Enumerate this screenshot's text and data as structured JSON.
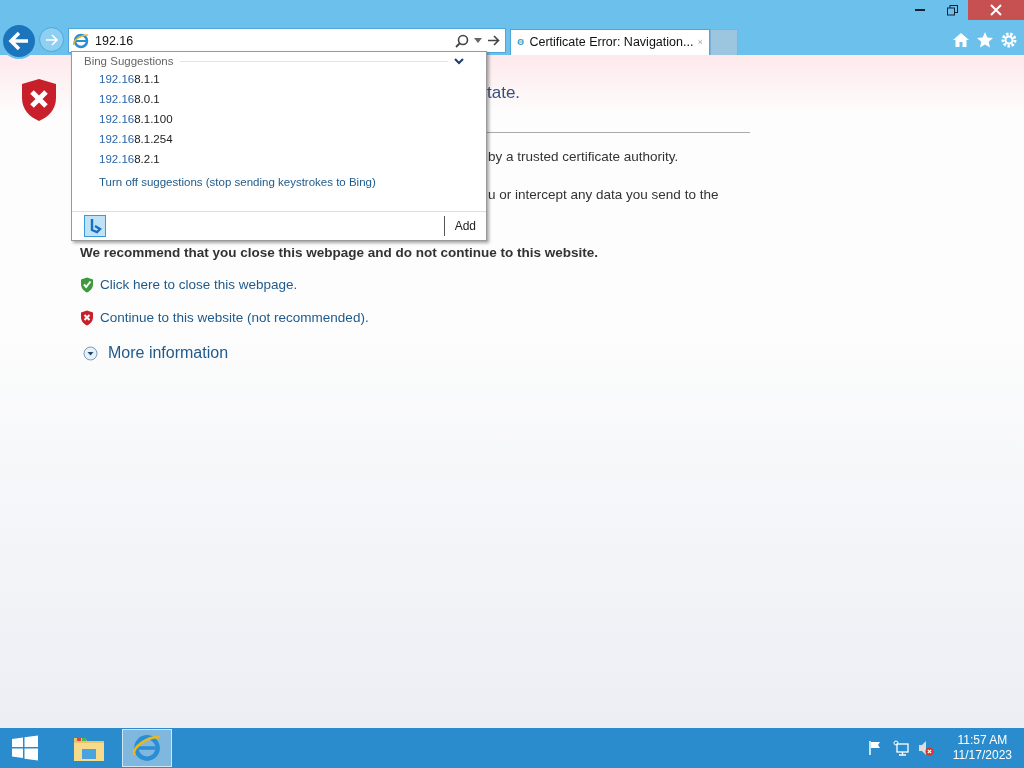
{
  "address_bar": {
    "value": "192.16"
  },
  "tabs": [
    {
      "label": "Certificate Error: Navigation...",
      "selected": true
    }
  ],
  "suggestions": {
    "header": "Bing Suggestions",
    "items": [
      {
        "typed": "192.16",
        "completion": "8.1.1"
      },
      {
        "typed": "192.16",
        "completion": "8.0.1"
      },
      {
        "typed": "192.16",
        "completion": "8.1.100"
      },
      {
        "typed": "192.16",
        "completion": "8.1.254"
      },
      {
        "typed": "192.16",
        "completion": "8.2.1"
      }
    ],
    "turn_off": "Turn off suggestions (stop sending keystrokes to Bing)",
    "add": "Add"
  },
  "page": {
    "title_fragment": "tate.",
    "lines": [
      "by a trusted certificate authority.",
      "u or intercept any data you send to the"
    ],
    "recommendation": "We recommend that you close this webpage and do not continue to this website.",
    "actions": [
      {
        "kind": "safe",
        "label": "Click here to close this webpage."
      },
      {
        "kind": "unsafe",
        "label": "Continue to this website (not recommended)."
      }
    ],
    "more_info": "More information"
  },
  "taskbar": {
    "apps": [
      {
        "kind": "folder",
        "selected": false
      },
      {
        "kind": "browser",
        "selected": true
      }
    ],
    "time": "11:57 AM",
    "date": "11/17/2023"
  }
}
